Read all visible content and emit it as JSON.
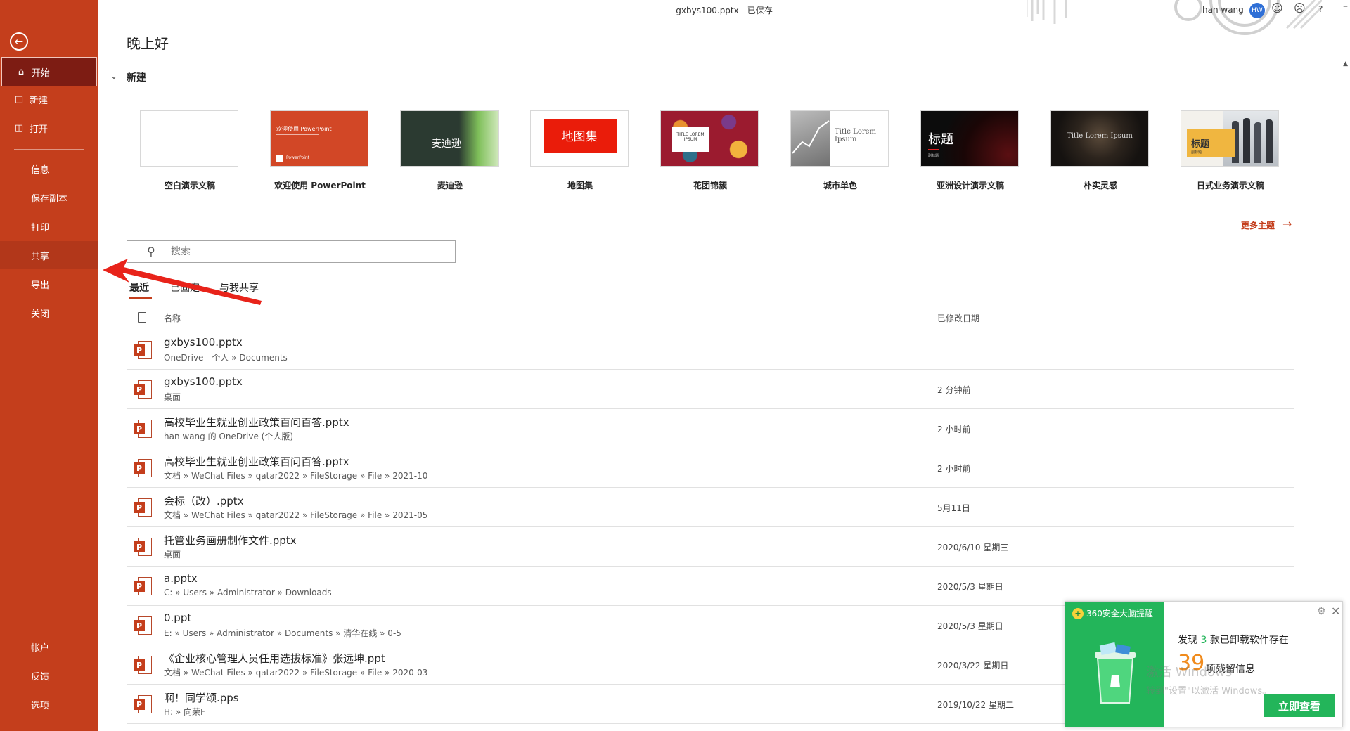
{
  "window": {
    "title": "gxbys100.pptx - 已保存",
    "user_name": "han wang",
    "user_initials": "HW"
  },
  "sidebar": {
    "back_icon": "arrow-left-circle-icon",
    "items": [
      {
        "label": "开始",
        "icon": "home-icon"
      },
      {
        "label": "新建",
        "icon": "new-document-icon"
      },
      {
        "label": "打开",
        "icon": "folder-open-icon"
      },
      {
        "label": "信息"
      },
      {
        "label": "保存副本"
      },
      {
        "label": "打印"
      },
      {
        "label": "共享"
      },
      {
        "label": "导出"
      },
      {
        "label": "关闭"
      }
    ],
    "bottom_items": [
      {
        "label": "帐户"
      },
      {
        "label": "反馈"
      },
      {
        "label": "选项"
      }
    ]
  },
  "header": {
    "greeting": "晚上好"
  },
  "new_section": {
    "title": "新建",
    "templates": [
      {
        "name": "空白演示文稿"
      },
      {
        "name": "欢迎使用 PowerPoint",
        "thumb_title": "欢迎使用 PowerPoint",
        "thumb_sub": "PowerPoint"
      },
      {
        "name": "麦迪逊",
        "thumb_title": "麦迪逊"
      },
      {
        "name": "地图集",
        "thumb_title": "地图集"
      },
      {
        "name": "花团锦簇",
        "thumb_title": "TITLE LOREM IPSUM"
      },
      {
        "name": "城市单色",
        "thumb_title": "Title Lorem Ipsum"
      },
      {
        "name": "亚洲设计演示文稿",
        "thumb_title": "标题",
        "thumb_sub": "副标题"
      },
      {
        "name": "朴实灵感",
        "thumb_title": "Title Lorem Ipsum"
      },
      {
        "name": "日式业务演示文稿",
        "thumb_title": "标题",
        "thumb_sub": "副标题"
      }
    ],
    "more_themes": "更多主题"
  },
  "search": {
    "placeholder": "搜索"
  },
  "tabs": [
    {
      "label": "最近"
    },
    {
      "label": "已固定"
    },
    {
      "label": "与我共享"
    }
  ],
  "file_list": {
    "col_name": "名称",
    "col_date": "已修改日期",
    "rows": [
      {
        "name": "gxbys100.pptx",
        "path": "OneDrive - 个人 » Documents",
        "date": ""
      },
      {
        "name": "gxbys100.pptx",
        "path": "桌面",
        "date": "2 分钟前"
      },
      {
        "name": "高校毕业生就业创业政策百问百答.pptx",
        "path": "han wang 的 OneDrive (个人版)",
        "date": "2 小时前"
      },
      {
        "name": "高校毕业生就业创业政策百问百答.pptx",
        "path": "文档 » WeChat Files » qatar2022 » FileStorage » File » 2021-10",
        "date": "2 小时前"
      },
      {
        "name": "会标（改）.pptx",
        "path": "文档 » WeChat Files » qatar2022 » FileStorage » File » 2021-05",
        "date": "5月11日"
      },
      {
        "name": "托管业务画册制作文件.pptx",
        "path": "桌面",
        "date": "2020/6/10 星期三"
      },
      {
        "name": "a.pptx",
        "path": "C: » Users » Administrator » Downloads",
        "date": "2020/5/3 星期日"
      },
      {
        "name": "0.ppt",
        "path": "E: » Users » Administrator » Documents » 清华在线 » 0-5",
        "date": "2020/5/3 星期日"
      },
      {
        "name": "《企业核心管理人员任用选拔标准》张远坤.ppt",
        "path": "文档 » WeChat Files » qatar2022 » FileStorage » File » 2020-03",
        "date": "2020/3/22 星期日"
      },
      {
        "name": "啊！同学颂.pps",
        "path": "H: » 向荣F",
        "date": "2019/10/22 星期二"
      }
    ]
  },
  "popup_360": {
    "brand": "360安全大脑提醒",
    "line1_prefix": "发现",
    "count1": "3",
    "line1_suffix": "款已卸载软件存在",
    "count2": "39",
    "line2": "项残留信息",
    "watermark1": "激活 Windows",
    "watermark2": "转到\"设置\"以激活 Windows。",
    "cta": "立即查看"
  },
  "colors": {
    "brand_sidebar": "#c43e1c",
    "active_item": "#7d1c13",
    "popup_green": "#23b55a",
    "popup_orange": "#f08b1d"
  }
}
